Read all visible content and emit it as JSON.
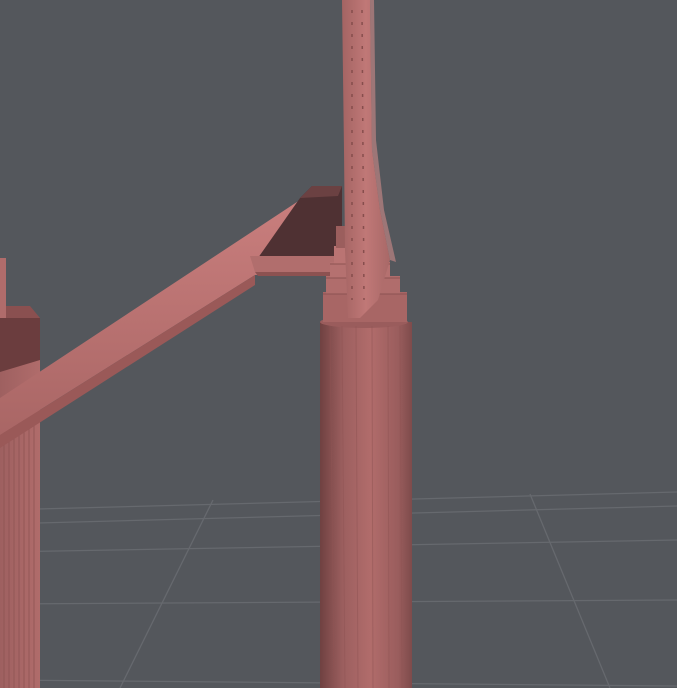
{
  "viewport": {
    "background_color": "#54575c",
    "grid_color": "#6a6d72",
    "model_color": "#b97271",
    "model_shadow_color": "#7a4645",
    "model_dark_color": "#4e3032",
    "model_highlight_color": "#cf8a88"
  }
}
